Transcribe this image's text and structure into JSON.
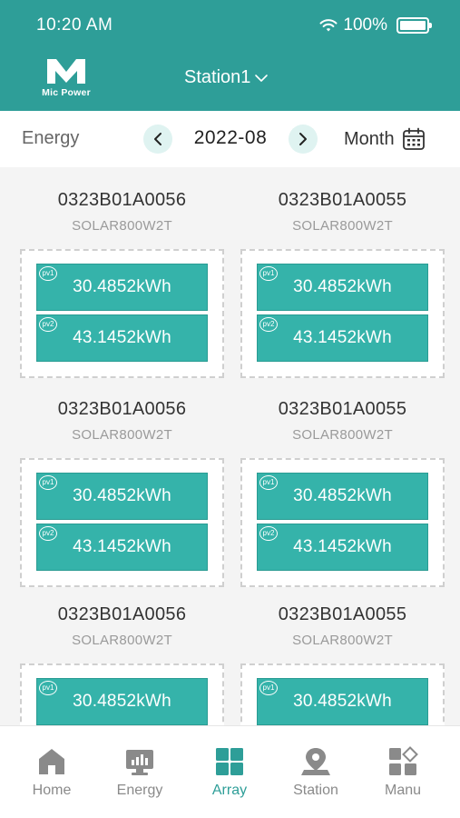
{
  "status_bar": {
    "time": "10:20 AM",
    "battery": "100%"
  },
  "header": {
    "logo_letter": "M",
    "logo_text": "Mic Power",
    "station": "Station1"
  },
  "toolbar": {
    "label": "Energy",
    "date": "2022-08",
    "period": "Month"
  },
  "colors": {
    "brand": "#2e9e98",
    "panel": "#35b3aa",
    "nav_bg": "#dff3f1"
  },
  "cards": [
    {
      "sn": "0323B01A0056",
      "model": "SOLAR800W2T",
      "pv": [
        {
          "badge": "pv1",
          "value": "30.4852kWh"
        },
        {
          "badge": "pv2",
          "value": "43.1452kWh"
        }
      ]
    },
    {
      "sn": "0323B01A0055",
      "model": "SOLAR800W2T",
      "pv": [
        {
          "badge": "pv1",
          "value": "30.4852kWh"
        },
        {
          "badge": "pv2",
          "value": "43.1452kWh"
        }
      ]
    },
    {
      "sn": "0323B01A0056",
      "model": "SOLAR800W2T",
      "pv": [
        {
          "badge": "pv1",
          "value": "30.4852kWh"
        },
        {
          "badge": "pv2",
          "value": "43.1452kWh"
        }
      ]
    },
    {
      "sn": "0323B01A0055",
      "model": "SOLAR800W2T",
      "pv": [
        {
          "badge": "pv1",
          "value": "30.4852kWh"
        },
        {
          "badge": "pv2",
          "value": "43.1452kWh"
        }
      ]
    },
    {
      "sn": "0323B01A0056",
      "model": "SOLAR800W2T",
      "pv": [
        {
          "badge": "pv1",
          "value": "30.4852kWh"
        }
      ]
    },
    {
      "sn": "0323B01A0055",
      "model": "SOLAR800W2T",
      "pv": [
        {
          "badge": "pv1",
          "value": "30.4852kWh"
        }
      ]
    }
  ],
  "tabs": [
    {
      "label": "Home",
      "icon": "home-icon",
      "active": false
    },
    {
      "label": "Energy",
      "icon": "energy-monitor-icon",
      "active": false
    },
    {
      "label": "Array",
      "icon": "array-grid-icon",
      "active": true
    },
    {
      "label": "Station",
      "icon": "station-pin-icon",
      "active": false
    },
    {
      "label": "Manu",
      "icon": "menu-tiles-icon",
      "active": false
    }
  ]
}
